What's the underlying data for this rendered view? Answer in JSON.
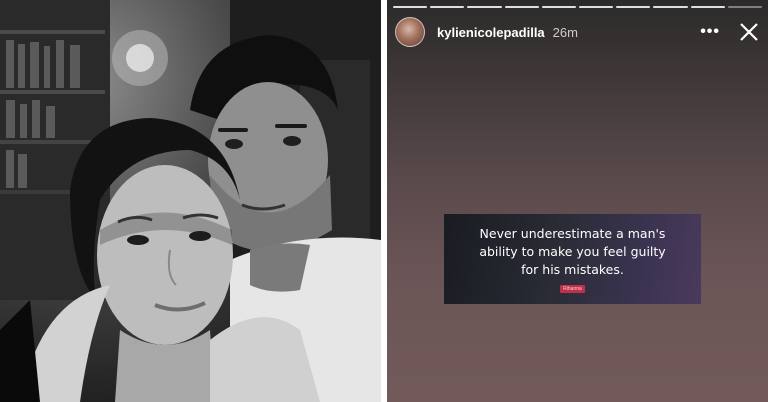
{
  "photo": {
    "description_icon": "couple-photo"
  },
  "story": {
    "username": "kylienicolepadilla",
    "time": "26m",
    "more_icon": "more-dots-icon",
    "close_icon": "close-icon",
    "more_label": "•••",
    "progress_segments": 10,
    "quote": {
      "text": "Never underestimate a man's ability to make you feel guilty for his mistakes.",
      "author": "Rihanna"
    }
  },
  "colors": {
    "quote_badge": "#c0304a",
    "story_bg_top": "#2b2a2a",
    "story_bg_bottom": "#725a5b"
  }
}
